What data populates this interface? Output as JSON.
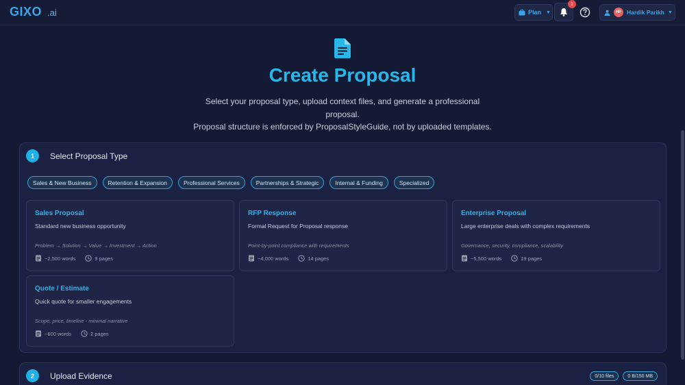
{
  "topbar": {
    "logo_main": "GIXO",
    "logo_suffix": ".ai",
    "plan_label": "Plan",
    "notification_count": "1",
    "user_initials": "HP",
    "user_name": "Hardik Parikh"
  },
  "hero": {
    "title": "Create Proposal",
    "description": "Select your proposal type, upload context files, and generate a professional proposal.",
    "note": "Proposal structure is enforced by ProposalStyleGuide, not by uploaded templates."
  },
  "step1": {
    "number": "1",
    "title": "Select Proposal Type",
    "categories": [
      "Sales & New Business",
      "Retention & Expansion",
      "Professional Services",
      "Partnerships & Strategic",
      "Internal & Funding",
      "Specialized"
    ],
    "types": [
      {
        "title": "Sales Proposal",
        "description": "Standard new business opportunity",
        "flow": "Problem → Solution → Value → Investment → Action",
        "words": "~2,500 words",
        "pages": "9 pages"
      },
      {
        "title": "RFP Response",
        "description": "Formal Request for Proposal response",
        "flow": "Point-by-point compliance with requirements",
        "words": "~4,000 words",
        "pages": "14 pages"
      },
      {
        "title": "Enterprise Proposal",
        "description": "Large enterprise deals with complex requirements",
        "flow": "Governance, security, compliance, scalability",
        "words": "~5,500 words",
        "pages": "19 pages"
      },
      {
        "title": "Quote / Estimate",
        "description": "Quick quote for smaller engagements",
        "flow": "Scope, price, timeline - minimal narrative",
        "words": "~600 words",
        "pages": "2 pages"
      }
    ]
  },
  "step2": {
    "number": "2",
    "title": "Upload Evidence",
    "file_count": "0/10 files",
    "size_usage": "0 B/150 MB"
  },
  "colors": {
    "accent": "#27b7e8",
    "background": "#141a33",
    "card": "#1e2546",
    "badge": "#e5484d"
  }
}
